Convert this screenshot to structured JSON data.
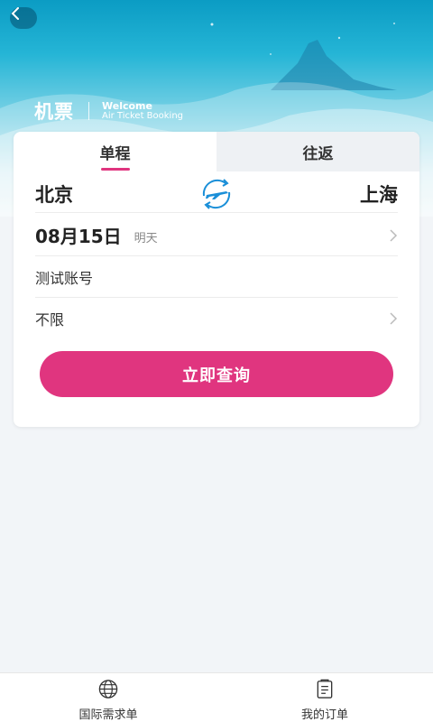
{
  "header": {
    "title": "机票",
    "welcome": "Welcome",
    "tagline": "Air Ticket Booking"
  },
  "tabs": [
    {
      "label": "单程",
      "active": true
    },
    {
      "label": "往返",
      "active": false
    }
  ],
  "search_form": {
    "from_city": "北京",
    "to_city": "上海",
    "date": "08月15日",
    "date_note": "明天",
    "account": "测试账号",
    "cabin_class": "不限",
    "submit_label": "立即查询"
  },
  "bottom_nav": [
    {
      "label": "国际需求单",
      "icon": "globe-icon"
    },
    {
      "label": "我的订单",
      "icon": "order-list-icon"
    }
  ],
  "colors": {
    "accent": "#e0357f",
    "header_top": "#0b9cc4",
    "swap_icon": "#1a8fd8"
  }
}
